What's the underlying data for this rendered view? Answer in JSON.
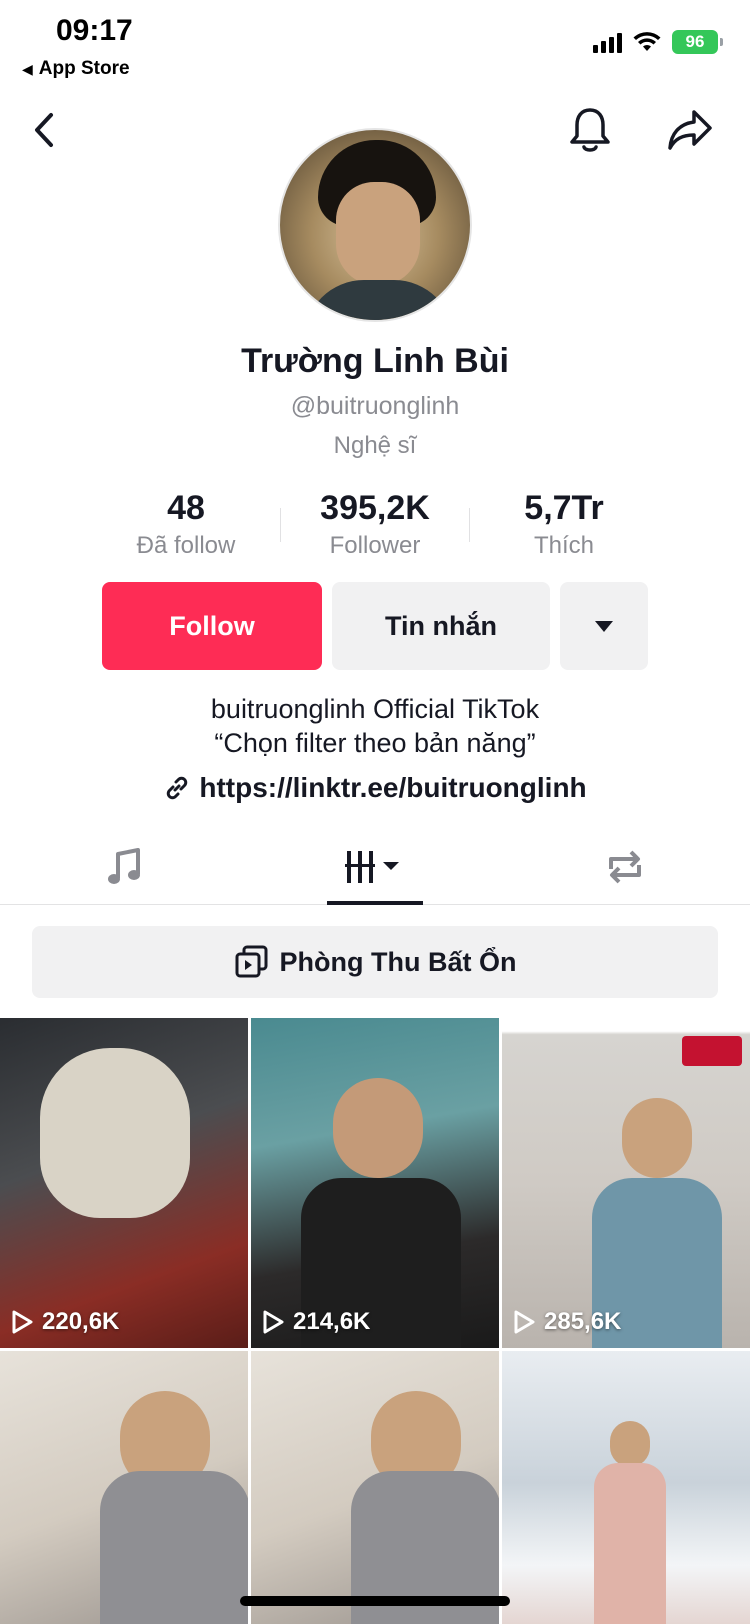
{
  "status_bar": {
    "time": "09:17",
    "back_app": "App Store",
    "battery": "96"
  },
  "profile": {
    "name": "Trường Linh Bùi",
    "handle": "@buitruonglinh",
    "category": "Nghệ sĩ"
  },
  "stats": [
    {
      "value": "48",
      "label": "Đã follow"
    },
    {
      "value": "395,2K",
      "label": "Follower"
    },
    {
      "value": "5,7Tr",
      "label": "Thích"
    }
  ],
  "actions": {
    "follow": "Follow",
    "message": "Tin nhắn"
  },
  "bio": {
    "line1": "buitruonglinh Official TikTok",
    "line2": "“Chọn filter theo bản năng”",
    "link": "https://linktr.ee/buitruonglinh"
  },
  "playlist": {
    "label": "Phòng Thu Bất Ổn"
  },
  "videos": [
    {
      "views": "220,6K"
    },
    {
      "views": "214,6K"
    },
    {
      "views": "285,6K"
    },
    {
      "views": ""
    },
    {
      "views": ""
    },
    {
      "views": ""
    }
  ],
  "colors": {
    "accent": "#fe2c55",
    "text": "#161823",
    "secondary": "#8a8b91",
    "button_bg": "#f1f1f2"
  }
}
